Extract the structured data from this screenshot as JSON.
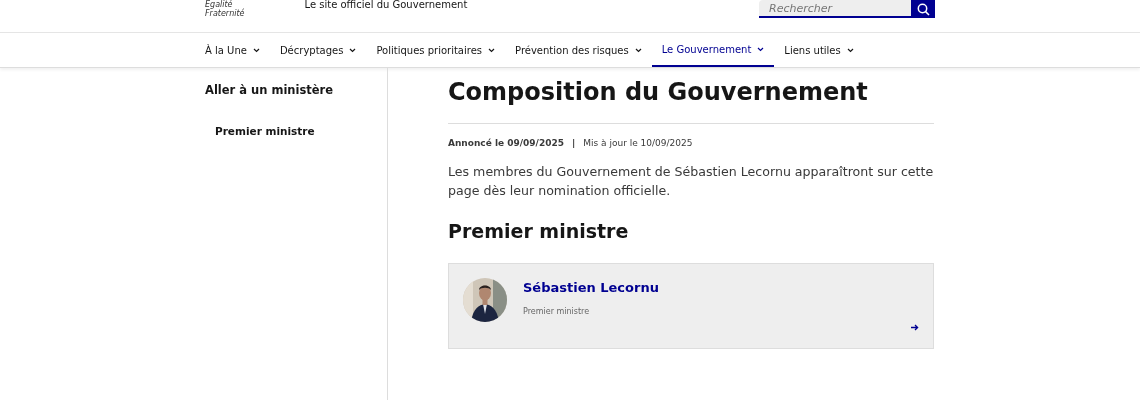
{
  "header": {
    "logo_motto": [
      "Égalité",
      "Fraternité"
    ],
    "tagline": "Le site officiel du Gouvernement",
    "search": {
      "placeholder": "Rechercher"
    }
  },
  "nav": [
    {
      "label": "À la Une",
      "selected": false
    },
    {
      "label": "Décryptages",
      "selected": false
    },
    {
      "label": "Politiques prioritaires",
      "selected": false
    },
    {
      "label": "Prévention des risques",
      "selected": false
    },
    {
      "label": "Le Gouvernement",
      "selected": true
    },
    {
      "label": "Liens utiles",
      "selected": false
    }
  ],
  "sidebar": {
    "title": "Aller à un ministère",
    "items": [
      {
        "label": "Premier ministre"
      }
    ]
  },
  "main": {
    "title": "Composition du Gouvernement",
    "announced": "Annoncé le 09/09/2025",
    "separator": "|",
    "updated": "Mis à jour le 10/09/2025",
    "intro": "Les membres du Gouvernement de Sébastien Lecornu apparaîtront sur cette page dès leur nomination officielle.",
    "section": "Premier ministre",
    "cards": [
      {
        "name": "Sébastien Lecornu",
        "role": "Premier ministre"
      }
    ]
  }
}
